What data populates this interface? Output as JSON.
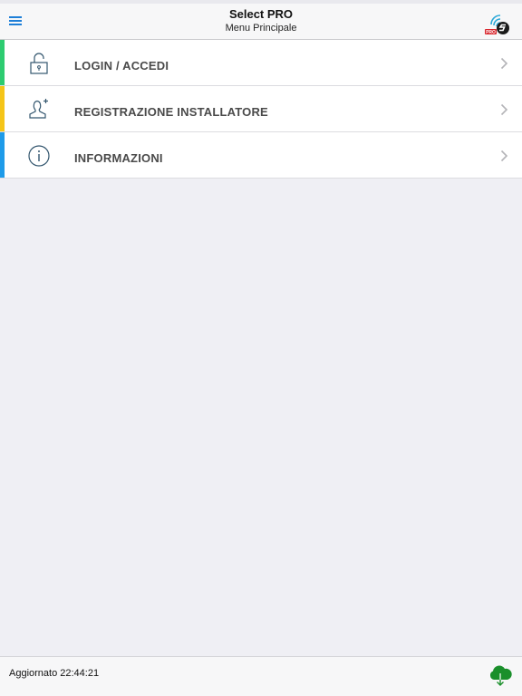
{
  "header": {
    "title": "Select PRO",
    "subtitle": "Menu Principale",
    "menu_icon": "hamburger-menu-icon",
    "logo_badge": "PRO"
  },
  "menu": {
    "items": [
      {
        "label": "LOGIN / ACCEDI",
        "icon": "unlocked-padlock-icon",
        "accent": "#2ecc71"
      },
      {
        "label": "REGISTRAZIONE INSTALLATORE",
        "icon": "add-user-icon",
        "accent": "#f5c518"
      },
      {
        "label": "INFORMAZIONI",
        "icon": "info-icon",
        "accent": "#1e9be9"
      }
    ]
  },
  "footer": {
    "updated_text": "Aggiornato 22:44:21",
    "cloud_icon": "cloud-download-icon"
  },
  "colors": {
    "accent_blue": "#1e7fd8",
    "cloud_green": "#1a8f2b",
    "background": "#efeff4"
  }
}
